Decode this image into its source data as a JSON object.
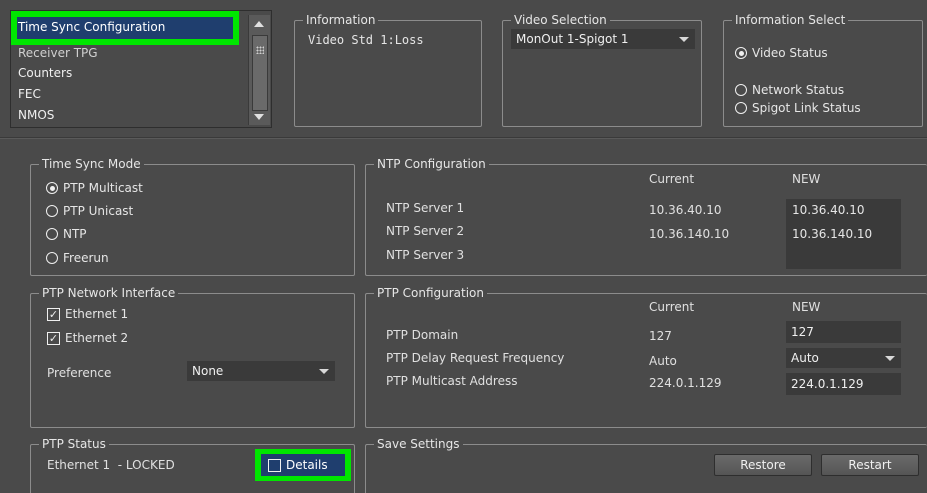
{
  "nav_list": {
    "items": [
      {
        "label": "Time Sync Configuration"
      },
      {
        "label": "Receiver TPG"
      },
      {
        "label": "Counters"
      },
      {
        "label": "FEC"
      },
      {
        "label": "NMOS"
      }
    ],
    "selected_index": 0
  },
  "information": {
    "title": "Information",
    "text": "Video Std 1:Loss"
  },
  "video_selection": {
    "title": "Video Selection",
    "value": "MonOut 1-Spigot 1"
  },
  "information_select": {
    "title": "Information Select",
    "options": [
      {
        "label": "Video Status",
        "selected": true
      },
      {
        "label": "Network Status",
        "selected": false
      },
      {
        "label": "Spigot Link Status",
        "selected": false
      }
    ]
  },
  "time_sync_mode": {
    "title": "Time Sync Mode",
    "options": [
      {
        "label": "PTP Multicast",
        "selected": true
      },
      {
        "label": "PTP Unicast",
        "selected": false
      },
      {
        "label": "NTP",
        "selected": false
      },
      {
        "label": "Freerun",
        "selected": false
      }
    ]
  },
  "ntp_config": {
    "title": "NTP Configuration",
    "col_current": "Current",
    "col_new": "NEW",
    "rows": [
      {
        "label": "NTP Server 1",
        "current": "10.36.40.10",
        "new": "10.36.40.10"
      },
      {
        "label": "NTP Server 2",
        "current": "10.36.140.10",
        "new": "10.36.140.10"
      },
      {
        "label": "NTP Server 3",
        "current": "",
        "new": ""
      }
    ]
  },
  "ptp_network_interface": {
    "title": "PTP Network Interface",
    "interfaces": [
      {
        "label": "Ethernet 1",
        "checked": true
      },
      {
        "label": "Ethernet 2",
        "checked": true
      }
    ],
    "preference_label": "Preference",
    "preference_value": "None"
  },
  "ptp_config": {
    "title": "PTP Configuration",
    "col_current": "Current",
    "col_new": "NEW",
    "rows": [
      {
        "label": "PTP Domain",
        "current": "127",
        "new": "127"
      },
      {
        "label": "PTP Delay Request Frequency",
        "current": "Auto",
        "new": "Auto"
      },
      {
        "label": "PTP Multicast Address",
        "current": "224.0.1.129",
        "new": "224.0.1.129"
      }
    ]
  },
  "ptp_status": {
    "title": "PTP Status",
    "text": "Ethernet 1  - LOCKED",
    "details_label": "Details",
    "details_checked": false
  },
  "save_settings": {
    "title": "Save Settings",
    "restore_label": "Restore",
    "restart_label": "Restart"
  },
  "colors": {
    "background": "#4a4a4a",
    "highlight": "#00e600",
    "selection": "#1f3e6e"
  },
  "icons": {
    "scroll_up": "triangle-up-icon",
    "scroll_down": "triangle-down-icon",
    "combo": "chevron-down-icon",
    "check": "check-icon"
  }
}
